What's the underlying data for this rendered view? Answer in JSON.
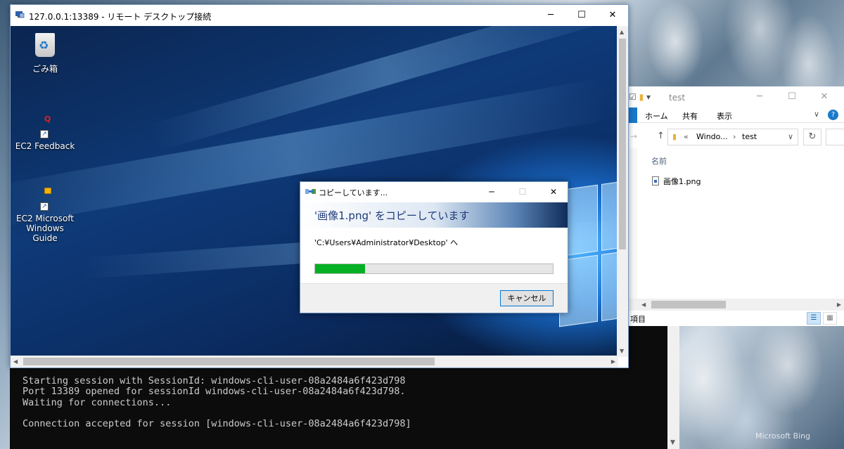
{
  "rdp_window": {
    "title": "127.0.0.1:13389 - リモート デスクトップ接続",
    "minimize": "─",
    "maximize": "☐",
    "close": "✕"
  },
  "desktop_icons": [
    {
      "label": "ごみ箱",
      "icon": "recycle-bin-icon"
    },
    {
      "label": "EC2 Feedback",
      "icon": "feedback-icon"
    },
    {
      "label": "EC2 Microsoft Windows Guide",
      "line1": "EC2 Microsoft",
      "line2": "Windows Guide",
      "icon": "guide-icon"
    }
  ],
  "copy_dialog": {
    "title": "コピーしています...",
    "heading": "'画像1.png' をコピーしています",
    "destination": "'C:¥Users¥Administrator¥Desktop' へ",
    "progress_fraction": 0.21,
    "cancel_label": "キャンセル",
    "progress_color": "#06b025"
  },
  "explorer": {
    "title": "test",
    "tabs": [
      "ホーム",
      "共有",
      "表示"
    ],
    "address": {
      "overflow": "«",
      "segment1": "Windo...",
      "separator": ">",
      "segment2": "test"
    },
    "column_header": "名前",
    "files": [
      {
        "name": "画像1.png",
        "icon": "image-file-icon"
      }
    ],
    "status_text": "項目"
  },
  "console": {
    "lines": [
      "Starting session with SessionId: windows-cli-user-08a2484a6f423d798",
      "Port 13389 opened for sessionId windows-cli-user-08a2484a6f423d798.",
      "Waiting for connections...",
      "",
      "Connection accepted for session [windows-cli-user-08a2484a6f423d798]"
    ]
  },
  "watermark": "Microsoft Bing",
  "colors": {
    "rdp_border": "#7a9cc6",
    "accent": "#0078d7",
    "explorer_tab": "#1979ca"
  }
}
